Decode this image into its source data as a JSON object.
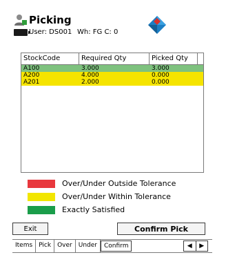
{
  "header": {
    "title": "Picking",
    "user": "User: DS001",
    "warehouse": "Wh: FG   C: 0"
  },
  "icons": {
    "user": "user-icon",
    "battery": "battery-icon",
    "logo": "diamond-logo-icon"
  },
  "grid": {
    "columns": [
      "StockCode",
      "Required Qty",
      "Picked Qty"
    ],
    "rows": [
      {
        "stock": "A100",
        "required": "3.000",
        "picked": "3.000",
        "status": "satisfied"
      },
      {
        "stock": "A200",
        "required": "4.000",
        "picked": "0.000",
        "status": "within"
      },
      {
        "stock": "A201",
        "required": "2.000",
        "picked": "0.000",
        "status": "within"
      }
    ]
  },
  "legend": {
    "outside": "Over/Under Outside Tolerance",
    "within": "Over/Under Within Tolerance",
    "satisfied": "Exactly Satisfied"
  },
  "buttons": {
    "exit": "Exit",
    "confirm": "Confirm Pick"
  },
  "tabs": {
    "items": "Items",
    "pick": "Pick",
    "over": "Over",
    "under": "Under",
    "confirm": "Confirm"
  },
  "colors": {
    "outside": "#e8383d",
    "within": "#f2e600",
    "satisfied": "#1a9d4a",
    "satisfied_row": "#7ec27e",
    "within_row": "#f5e400"
  }
}
